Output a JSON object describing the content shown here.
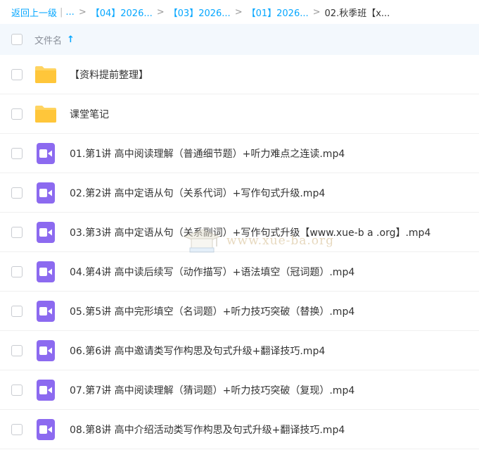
{
  "breadcrumb": {
    "back": "返回上一级",
    "pipe": "|",
    "ellipsis": "...",
    "crumbs": [
      "【04】2026...",
      "【03】2026...",
      "【01】2026..."
    ],
    "current": "02.秋季班【x...",
    "separator": ">"
  },
  "header": {
    "name_label": "文件名",
    "sort_icon": "arrow-up-icon",
    "sort_glyph": "↑"
  },
  "files": [
    {
      "type": "folder",
      "name": "【资料提前整理】"
    },
    {
      "type": "folder",
      "name": "课堂笔记"
    },
    {
      "type": "video",
      "name": "01.第1讲 高中阅读理解（普通细节题）+听力难点之连读.mp4"
    },
    {
      "type": "video",
      "name": "02.第2讲 高中定语从句（关系代词）+写作句式升级.mp4"
    },
    {
      "type": "video",
      "name": "03.第3讲 高中定语从句（关系副词）+写作句式升级【www.xue-b a .org】.mp4"
    },
    {
      "type": "video",
      "name": "04.第4讲 高中读后续写（动作描写）+语法填空（冠词题）.mp4"
    },
    {
      "type": "video",
      "name": "05.第5讲 高中完形填空（名词题）+听力技巧突破（替换）.mp4"
    },
    {
      "type": "video",
      "name": "06.第6讲 高中邀请类写作构思及句式升级+翻译技巧.mp4"
    },
    {
      "type": "video",
      "name": "07.第7讲 高中阅读理解（猜词题）+听力技巧突破（复现）.mp4"
    },
    {
      "type": "video",
      "name": "08.第8讲 高中介绍活动类写作构思及句式升级+翻译技巧.mp4"
    }
  ],
  "watermark": {
    "text": "www.xue-ba.org"
  },
  "colors": {
    "accent": "#06a7ff",
    "folder": "#ffd461",
    "video": "#8c6af0",
    "header_bg": "#f3f8fd"
  }
}
